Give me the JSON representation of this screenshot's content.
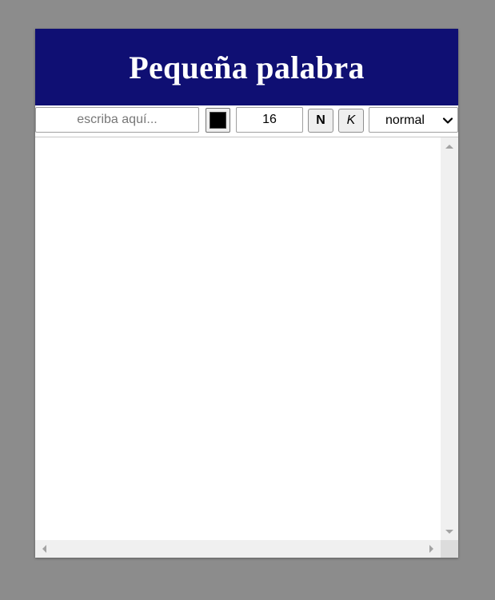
{
  "app": {
    "title": "Pequeña palabra",
    "header_color": "#0f0f73"
  },
  "toolbar": {
    "text_input": {
      "placeholder": "escriba aquí...",
      "value": ""
    },
    "color_picker": {
      "value": "#000000",
      "icon": "color-swatch"
    },
    "font_size": {
      "value": "16"
    },
    "bold_label": "N",
    "italic_label": "K",
    "style_select": {
      "selected": "normal",
      "icon": "chevron-down-icon"
    }
  },
  "editor": {
    "content": "",
    "scrollbars": {
      "vertical": [
        "scroll-up-icon",
        "scroll-down-icon"
      ],
      "horizontal": [
        "scroll-left-icon",
        "scroll-right-icon"
      ]
    }
  }
}
